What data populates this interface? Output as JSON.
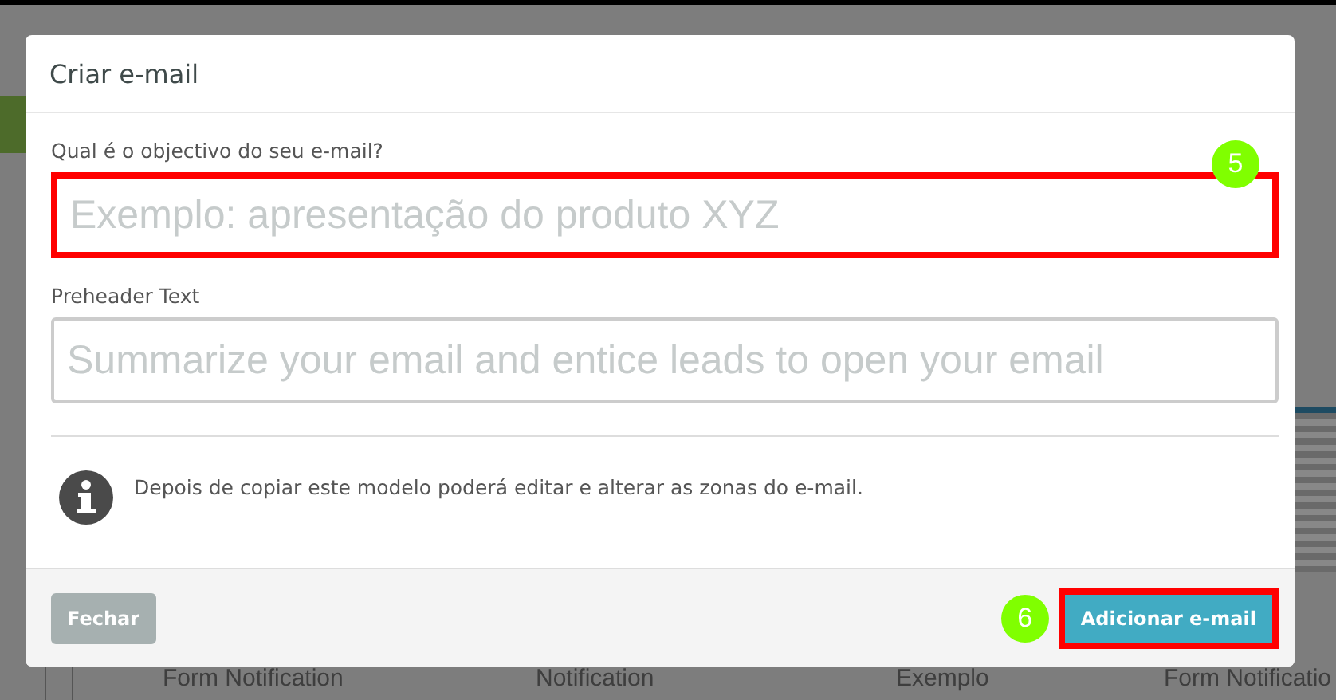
{
  "background": {
    "labels": [
      "Form Notification",
      "Notification",
      "Exemplo",
      "Form Notificatio"
    ]
  },
  "dialog": {
    "title": "Criar e-mail",
    "fields": [
      {
        "label": "Qual é o objectivo do seu e-mail?",
        "placeholder": "Exemplo: apresentação do produto XYZ",
        "highlighted": true,
        "badge": "5"
      },
      {
        "label": "Preheader Text",
        "placeholder": "Summarize your email and entice leads to open your email",
        "highlighted": false
      }
    ],
    "info": "Depois de copiar este modelo poderá editar e alterar as zonas do e-mail.",
    "buttons": [
      {
        "label": "Fechar",
        "kind": "secondary",
        "highlighted": false
      },
      {
        "label": "Adicionar e-mail",
        "kind": "primary",
        "highlighted": true,
        "badge": "6"
      }
    ]
  }
}
